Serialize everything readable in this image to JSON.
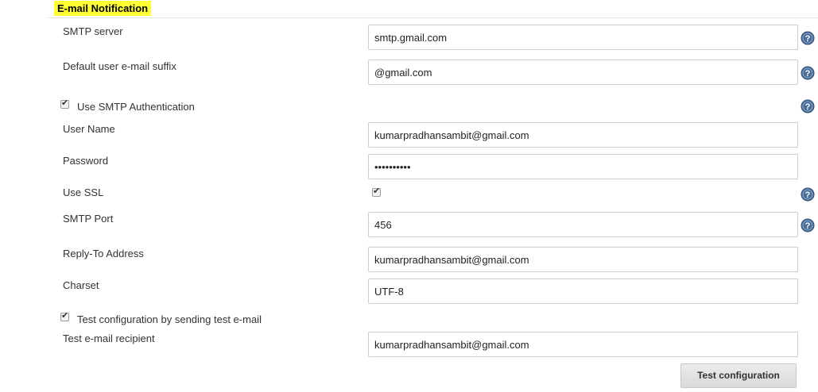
{
  "section": {
    "title": "E-mail Notification"
  },
  "fields": {
    "smtp_server": {
      "label": "SMTP server",
      "value": "smtp.gmail.com"
    },
    "email_suffix": {
      "label": "Default user e-mail suffix",
      "value": "@gmail.com"
    },
    "use_smtp_auth": {
      "label": "Use SMTP Authentication",
      "checked": true
    },
    "user_name": {
      "label": "User Name",
      "value": "kumarpradhansambit@gmail.com"
    },
    "password": {
      "label": "Password",
      "value": "••••••••••"
    },
    "use_ssl": {
      "label": "Use SSL",
      "checked": true
    },
    "smtp_port": {
      "label": "SMTP Port",
      "value": "456"
    },
    "reply_to": {
      "label": "Reply-To Address",
      "value": "kumarpradhansambit@gmail.com"
    },
    "charset": {
      "label": "Charset",
      "value": "UTF-8"
    },
    "test_config": {
      "label": "Test configuration by sending test e-mail",
      "checked": true
    },
    "test_recipient": {
      "label": "Test e-mail recipient",
      "value": "kumarpradhansambit@gmail.com"
    }
  },
  "buttons": {
    "test_configuration": "Test configuration"
  },
  "icons": {
    "help": "help-icon",
    "check": "check-icon"
  },
  "colors": {
    "highlight": "#ffff33",
    "help_icon": "#4a6d9c",
    "field_border": "#cccccc"
  }
}
